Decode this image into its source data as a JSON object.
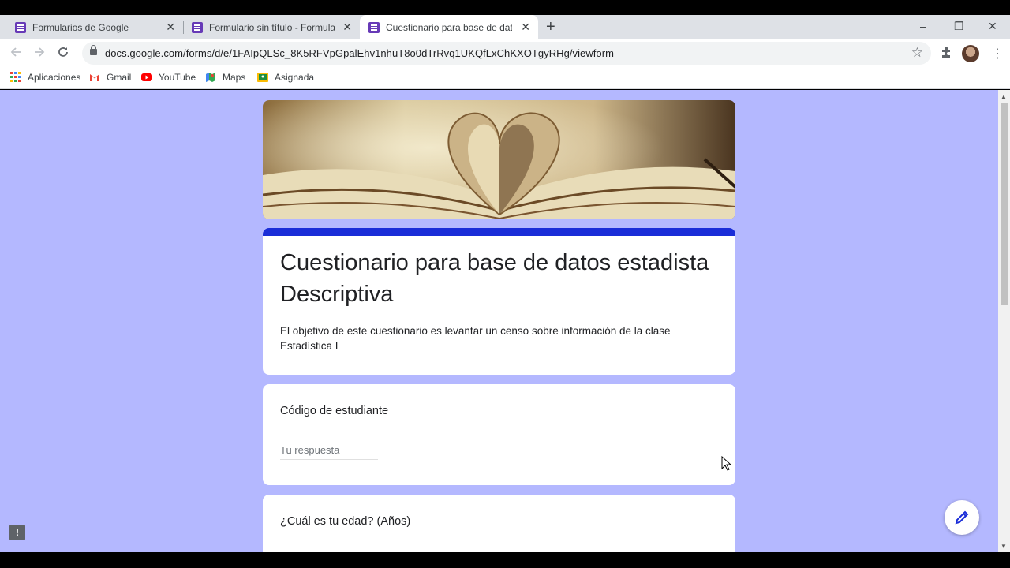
{
  "browser": {
    "tabs": [
      {
        "title": "Formularios de Google",
        "active": false
      },
      {
        "title": "Formulario sin título - Formularios de Google",
        "active": false
      },
      {
        "title": "Cuestionario para base de datos estadista Descriptiva",
        "active": true
      }
    ],
    "new_tab_label": "+",
    "close_label": "✕",
    "window_controls": {
      "minimize": "–",
      "restore": "❐",
      "close": "✕"
    },
    "url": "docs.google.com/forms/d/e/1FAIpQLSc_8K5RFVpGpalEhv1nhuT8o0dTrRvq1UKQfLxChKXOTgyRHg/viewform",
    "bookmarks": [
      {
        "label": "Aplicaciones",
        "icon": "apps-grid-icon"
      },
      {
        "label": "Gmail",
        "icon": "gmail-icon"
      },
      {
        "label": "YouTube",
        "icon": "youtube-icon"
      },
      {
        "label": "Maps",
        "icon": "maps-icon"
      },
      {
        "label": "Asignada",
        "icon": "classroom-icon"
      }
    ]
  },
  "form": {
    "title": "Cuestionario para base de datos estadista Descriptiva",
    "description": "El objetivo de este cuestionario es levantar un censo sobre información de la clase Estadística I",
    "accent_color": "#1a2dd8",
    "background_color": "#b4b8ff",
    "questions": [
      {
        "label": "Código de estudiante",
        "placeholder": "Tu respuesta"
      },
      {
        "label": "¿Cuál es tu edad? (Años)"
      }
    ]
  }
}
